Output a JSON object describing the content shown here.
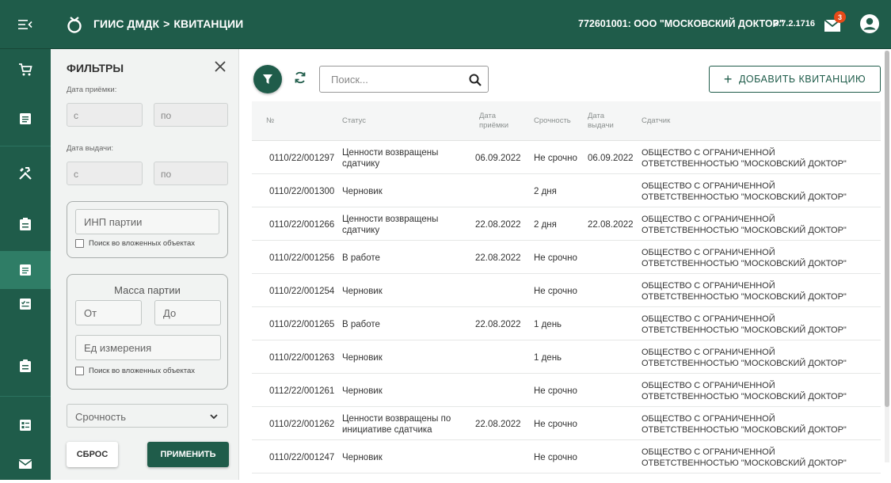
{
  "header": {
    "app_name": "ГИИС ДМДК",
    "separator": ">",
    "section": "КВИТАНЦИИ",
    "organization": "772601001: ООО \"МОСКОВСКИЙ ДОКТОР\"",
    "version": "3.7.2.1716",
    "notifications_count": "3"
  },
  "filters": {
    "title": "ФИЛЬТРЫ",
    "receipt_date_label": "Дата приёмки:",
    "receipt_from": "с",
    "receipt_to": "по",
    "issue_date_label": "Дата выдачи:",
    "issue_from": "с",
    "issue_to": "по",
    "inp_placeholder": "ИНП партии",
    "nested_search_1": "Поиск во вложенных объектах",
    "mass_title": "Масса партии",
    "mass_from": "От",
    "mass_to": "До",
    "unit_placeholder": "Ед измерения",
    "nested_search_2": "Поиск во вложенных объектах",
    "urgency_select": "Срочность",
    "reset_label": "СБРОС",
    "apply_label": "ПРИМЕНИТЬ"
  },
  "toolbar": {
    "search_placeholder": "Поиск...",
    "add_label": "ДОБАВИТЬ КВИТАНЦИЮ"
  },
  "table": {
    "columns": {
      "number": "№",
      "status": "Статус",
      "receipt_date": "Дата приёмки",
      "urgency": "Срочность",
      "issue_date": "Дата выдачи",
      "depositor": "Сдатчик"
    },
    "rows": [
      {
        "number": "0110/22/001297",
        "status": "Ценности возвращены сдатчику",
        "receipt_date": "06.09.2022",
        "urgency": "Не срочно",
        "issue_date": "06.09.2022",
        "depositor_l1": "ОБЩЕСТВО С ОГРАНИЧЕННОЙ",
        "depositor_l2": "ОТВЕТСТВЕННОСТЬЮ \"МОСКОВСКИЙ ДОКТОР\""
      },
      {
        "number": "0110/22/001300",
        "status": "Черновик",
        "receipt_date": "",
        "urgency": "2 дня",
        "issue_date": "",
        "depositor_l1": "ОБЩЕСТВО С ОГРАНИЧЕННОЙ",
        "depositor_l2": "ОТВЕТСТВЕННОСТЬЮ \"МОСКОВСКИЙ ДОКТОР\""
      },
      {
        "number": "0110/22/001266",
        "status": "Ценности возвращены сдатчику",
        "receipt_date": "22.08.2022",
        "urgency": "2 дня",
        "issue_date": "22.08.2022",
        "depositor_l1": "ОБЩЕСТВО С ОГРАНИЧЕННОЙ",
        "depositor_l2": "ОТВЕТСТВЕННОСТЬЮ \"МОСКОВСКИЙ ДОКТОР\""
      },
      {
        "number": "0110/22/001256",
        "status": "В работе",
        "receipt_date": "22.08.2022",
        "urgency": "Не срочно",
        "issue_date": "",
        "depositor_l1": "ОБЩЕСТВО С ОГРАНИЧЕННОЙ",
        "depositor_l2": "ОТВЕТСТВЕННОСТЬЮ \"МОСКОВСКИЙ ДОКТОР\""
      },
      {
        "number": "0110/22/001254",
        "status": "Черновик",
        "receipt_date": "",
        "urgency": "Не срочно",
        "issue_date": "",
        "depositor_l1": "ОБЩЕСТВО С ОГРАНИЧЕННОЙ",
        "depositor_l2": "ОТВЕТСТВЕННОСТЬЮ \"МОСКОВСКИЙ ДОКТОР\""
      },
      {
        "number": "0110/22/001265",
        "status": "В работе",
        "receipt_date": "22.08.2022",
        "urgency": "1 день",
        "issue_date": "",
        "depositor_l1": "ОБЩЕСТВО С ОГРАНИЧЕННОЙ",
        "depositor_l2": "ОТВЕТСТВЕННОСТЬЮ \"МОСКОВСКИЙ ДОКТОР\""
      },
      {
        "number": "0110/22/001263",
        "status": "Черновик",
        "receipt_date": "",
        "urgency": "1 день",
        "issue_date": "",
        "depositor_l1": "ОБЩЕСТВО С ОГРАНИЧЕННОЙ",
        "depositor_l2": "ОТВЕТСТВЕННОСТЬЮ \"МОСКОВСКИЙ ДОКТОР\""
      },
      {
        "number": "0112/22/001261",
        "status": "Черновик",
        "receipt_date": "",
        "urgency": "Не срочно",
        "issue_date": "",
        "depositor_l1": "ОБЩЕСТВО С ОГРАНИЧЕННОЙ",
        "depositor_l2": "ОТВЕТСТВЕННОСТЬЮ \"МОСКОВСКИЙ ДОКТОР\""
      },
      {
        "number": "0110/22/001262",
        "status": "Ценности возвращены по инициативе сдатчика",
        "receipt_date": "22.08.2022",
        "urgency": "Не срочно",
        "issue_date": "",
        "depositor_l1": "ОБЩЕСТВО С ОГРАНИЧЕННОЙ",
        "depositor_l2": "ОТВЕТСТВЕННОСТЬЮ \"МОСКОВСКИЙ ДОКТОР\""
      },
      {
        "number": "0110/22/001247",
        "status": "Черновик",
        "receipt_date": "",
        "urgency": "Не срочно",
        "issue_date": "",
        "depositor_l1": "ОБЩЕСТВО С ОГРАНИЧЕННОЙ",
        "depositor_l2": "ОТВЕТСТВЕННОСТЬЮ \"МОСКОВСКИЙ ДОКТОР\""
      }
    ]
  },
  "rail_icons": [
    "cart-icon",
    "list-icon",
    "tools-icon",
    "badge-icon",
    "document-icon",
    "checklist-icon",
    "clipboard-icon",
    "card-icon",
    "mail-icon"
  ],
  "colors": {
    "brand": "#1f5c4a",
    "badge": "#e64a19"
  }
}
